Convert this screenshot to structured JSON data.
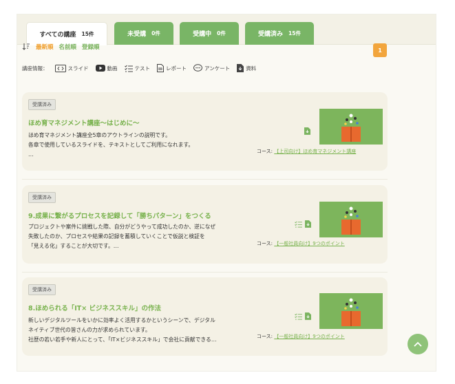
{
  "tabs": [
    {
      "label": "すべての講座",
      "count": "15件"
    },
    {
      "label": "未受講",
      "count": "0件"
    },
    {
      "label": "受講中",
      "count": "0件"
    },
    {
      "label": "受講済み",
      "count": "15件"
    }
  ],
  "sort": {
    "options": [
      "最新順",
      "名前順",
      "登録順"
    ],
    "active": "最新順"
  },
  "pagination": {
    "current": "1"
  },
  "legend": {
    "heading": "講座情報：",
    "items": [
      {
        "label": "スライド",
        "icon": "slide-icon"
      },
      {
        "label": "動画",
        "icon": "video-icon"
      },
      {
        "label": "テスト",
        "icon": "test-icon"
      },
      {
        "label": "レポート",
        "icon": "report-icon"
      },
      {
        "label": "アンケート",
        "icon": "survey-icon"
      },
      {
        "label": "資料",
        "icon": "document-icon"
      }
    ]
  },
  "courses": [
    {
      "status": "受講済み",
      "title": "ほめ育マネジメント講座〜はじめに〜",
      "desc": [
        "ほめ育マネジメント講座全5章のアウトラインの説明です。",
        "各章で使用しているスライドを、テキストとしてご利用になれます。",
        "…"
      ],
      "course_prefix": "コース:",
      "course_link": "【上司向け】ほめ育マネジメント講座",
      "icons": [
        "document-icon"
      ]
    },
    {
      "status": "受講済み",
      "title": "9.成果に繋がるプロセスを記録して「勝ちパターン」をつくる",
      "desc": [
        "プロジェクトや案件に挑戦した際、自分がどうやって成功したのか、逆になぜ",
        "失敗したのか、プロセスや結果の記録を蓄積していくことで仮説と検証を",
        "「見える化」することが大切です。…"
      ],
      "course_prefix": "コース:",
      "course_link": "【一般社員向け】9つのポイント",
      "icons": [
        "test-icon",
        "document-icon"
      ]
    },
    {
      "status": "受講済み",
      "title": "8.ほめられる「IT× ビジネススキル」の作法",
      "desc": [
        "新しいデジタルツールをいかに効率よく活用するかというシーンで、デジタル",
        "ネイティブ世代の皆さんの力が求められています。",
        "社歴の若い若手や新人にとって、「IT×ビジネススキル」で会社に貢献できる…"
      ],
      "course_prefix": "コース:",
      "course_link": "【一般社員向け】9つのポイント",
      "icons": [
        "test-icon",
        "document-icon"
      ]
    }
  ],
  "colors": {
    "accent_green": "#78b24d",
    "tab_green": "#79b566",
    "sort_active": "#f0a030",
    "page_badge": "#f2a53c"
  }
}
